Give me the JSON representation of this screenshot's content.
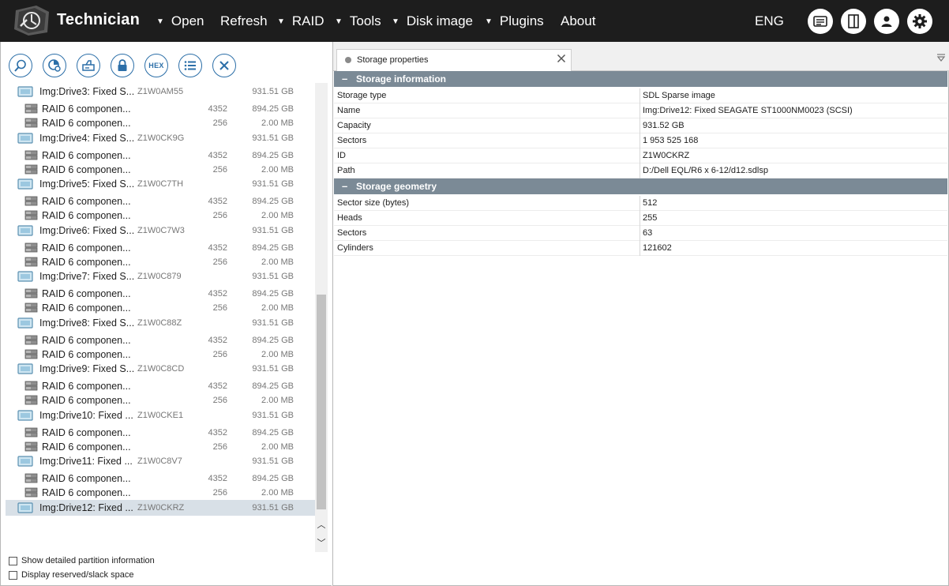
{
  "app": {
    "title": "Technician"
  },
  "menu": [
    {
      "label": "Open",
      "caret": true
    },
    {
      "label": "Refresh",
      "caret": false
    },
    {
      "label": "RAID",
      "caret": true
    },
    {
      "label": "Tools",
      "caret": true
    },
    {
      "label": "Disk image",
      "caret": true
    },
    {
      "label": "Plugins",
      "caret": true
    },
    {
      "label": "About",
      "caret": false
    }
  ],
  "language": "ENG",
  "header_buttons": [
    "log-icon",
    "panel-toggle-icon",
    "user-icon",
    "gear-icon"
  ],
  "toolbar": [
    "search-icon",
    "scan-icon",
    "image-icon",
    "lock-icon",
    "hex-icon",
    "list-icon",
    "close-icon"
  ],
  "toolbar_hex_label": "HEX",
  "tree": [
    {
      "type": "drive",
      "name": "Img:Drive3: Fixed S...",
      "serial": "Z1W0AM55",
      "size": "931.51 GB"
    },
    {
      "type": "part",
      "name": "RAID 6 componen...",
      "num": "4352",
      "size": "894.25 GB"
    },
    {
      "type": "part",
      "name": "RAID 6 componen...",
      "num": "256",
      "size": "2.00 MB"
    },
    {
      "type": "drive",
      "name": "Img:Drive4: Fixed S...",
      "serial": "Z1W0CK9G",
      "size": "931.51 GB"
    },
    {
      "type": "part",
      "name": "RAID 6 componen...",
      "num": "4352",
      "size": "894.25 GB"
    },
    {
      "type": "part",
      "name": "RAID 6 componen...",
      "num": "256",
      "size": "2.00 MB"
    },
    {
      "type": "drive",
      "name": "Img:Drive5: Fixed S...",
      "serial": "Z1W0C7TH",
      "size": "931.51 GB"
    },
    {
      "type": "part",
      "name": "RAID 6 componen...",
      "num": "4352",
      "size": "894.25 GB"
    },
    {
      "type": "part",
      "name": "RAID 6 componen...",
      "num": "256",
      "size": "2.00 MB"
    },
    {
      "type": "drive",
      "name": "Img:Drive6: Fixed S...",
      "serial": "Z1W0C7W3",
      "size": "931.51 GB"
    },
    {
      "type": "part",
      "name": "RAID 6 componen...",
      "num": "4352",
      "size": "894.25 GB"
    },
    {
      "type": "part",
      "name": "RAID 6 componen...",
      "num": "256",
      "size": "2.00 MB"
    },
    {
      "type": "drive",
      "name": "Img:Drive7: Fixed S...",
      "serial": "Z1W0C879",
      "size": "931.51 GB"
    },
    {
      "type": "part",
      "name": "RAID 6 componen...",
      "num": "4352",
      "size": "894.25 GB"
    },
    {
      "type": "part",
      "name": "RAID 6 componen...",
      "num": "256",
      "size": "2.00 MB"
    },
    {
      "type": "drive",
      "name": "Img:Drive8: Fixed S...",
      "serial": "Z1W0C88Z",
      "size": "931.51 GB"
    },
    {
      "type": "part",
      "name": "RAID 6 componen...",
      "num": "4352",
      "size": "894.25 GB"
    },
    {
      "type": "part",
      "name": "RAID 6 componen...",
      "num": "256",
      "size": "2.00 MB"
    },
    {
      "type": "drive",
      "name": "Img:Drive9: Fixed S...",
      "serial": "Z1W0C8CD",
      "size": "931.51 GB"
    },
    {
      "type": "part",
      "name": "RAID 6 componen...",
      "num": "4352",
      "size": "894.25 GB"
    },
    {
      "type": "part",
      "name": "RAID 6 componen...",
      "num": "256",
      "size": "2.00 MB"
    },
    {
      "type": "drive",
      "name": "Img:Drive10: Fixed ...",
      "serial": "Z1W0CKE1",
      "size": "931.51 GB"
    },
    {
      "type": "part",
      "name": "RAID 6 componen...",
      "num": "4352",
      "size": "894.25 GB"
    },
    {
      "type": "part",
      "name": "RAID 6 componen...",
      "num": "256",
      "size": "2.00 MB"
    },
    {
      "type": "drive",
      "name": "Img:Drive11: Fixed ...",
      "serial": "Z1W0C8V7",
      "size": "931.51 GB"
    },
    {
      "type": "part",
      "name": "RAID 6 componen...",
      "num": "4352",
      "size": "894.25 GB"
    },
    {
      "type": "part",
      "name": "RAID 6 componen...",
      "num": "256",
      "size": "2.00 MB"
    },
    {
      "type": "drive",
      "name": "Img:Drive12: Fixed ...",
      "serial": "Z1W0CKRZ",
      "size": "931.51 GB",
      "selected": true
    }
  ],
  "options": {
    "show_partition_info": "Show detailed partition information",
    "display_slack": "Display reserved/slack space"
  },
  "tab": {
    "label": "Storage properties"
  },
  "sections": [
    {
      "title": "Storage information",
      "rows": [
        {
          "key": "Storage type",
          "value": "SDL Sparse image"
        },
        {
          "key": "Name",
          "value": "Img:Drive12: Fixed SEAGATE ST1000NM0023 (SCSI)"
        },
        {
          "key": "Capacity",
          "value": "931.52 GB"
        },
        {
          "key": "Sectors",
          "value": "1 953 525 168"
        },
        {
          "key": "ID",
          "value": "Z1W0CKRZ"
        },
        {
          "key": "Path",
          "value": "D:/Dell EQL/R6 x 6-12/d12.sdlsp"
        }
      ]
    },
    {
      "title": "Storage geometry",
      "rows": [
        {
          "key": "Sector size (bytes)",
          "value": "512"
        },
        {
          "key": "Heads",
          "value": "255"
        },
        {
          "key": "Sectors",
          "value": "63"
        },
        {
          "key": "Cylinders",
          "value": "121602"
        }
      ]
    }
  ],
  "colors": {
    "topbar": "#1d1d1d",
    "accent_icon": "#2c6fa8",
    "section_header": "#7b8a96",
    "selected_row": "#d8e0e7"
  }
}
